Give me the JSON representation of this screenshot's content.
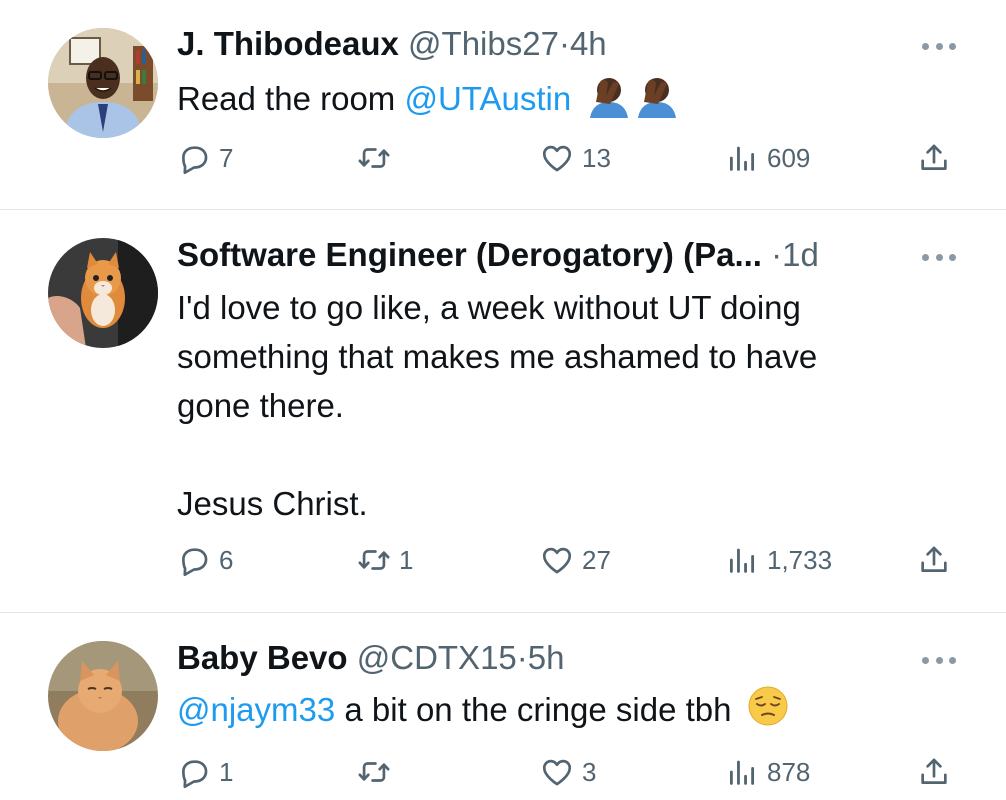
{
  "tweets": [
    {
      "name": "J. Thibodeaux",
      "handle": "@Thibs27",
      "dot": "·",
      "time": "4h",
      "body_lines": [],
      "mention": "@UTAustin",
      "body_prefix": "Read the room",
      "emojis": [
        "facepalm-emoji",
        "facepalm-emoji"
      ],
      "replies": "7",
      "retweets": "",
      "likes": "13",
      "views": "609"
    },
    {
      "name": "Software Engineer (Derogatory) (Pa...",
      "handle": "",
      "dot": "·",
      "time": "1d",
      "body_lines": [
        "I'd love to go like, a week without UT doing",
        "something that makes me ashamed to have",
        "gone there.",
        "",
        "Jesus Christ."
      ],
      "replies": "6",
      "retweets": "1",
      "likes": "27",
      "views": "1,733"
    },
    {
      "name": "Baby Bevo",
      "handle": "@CDTX15",
      "dot": "·",
      "time": "5h",
      "mention": "@njaym33",
      "body_suffix": "a bit on the cringe side tbh",
      "emojis": [
        "pensive-face-emoji"
      ],
      "replies": "1",
      "retweets": "",
      "likes": "3",
      "views": "878"
    }
  ],
  "colors": {
    "text": "#0f1419",
    "secondary": "#536471",
    "link": "#1d9bf0",
    "divider": "#e1e6ea"
  },
  "icons": [
    "reply-icon",
    "retweet-icon",
    "like-icon",
    "views-icon",
    "share-icon",
    "more-icon"
  ]
}
